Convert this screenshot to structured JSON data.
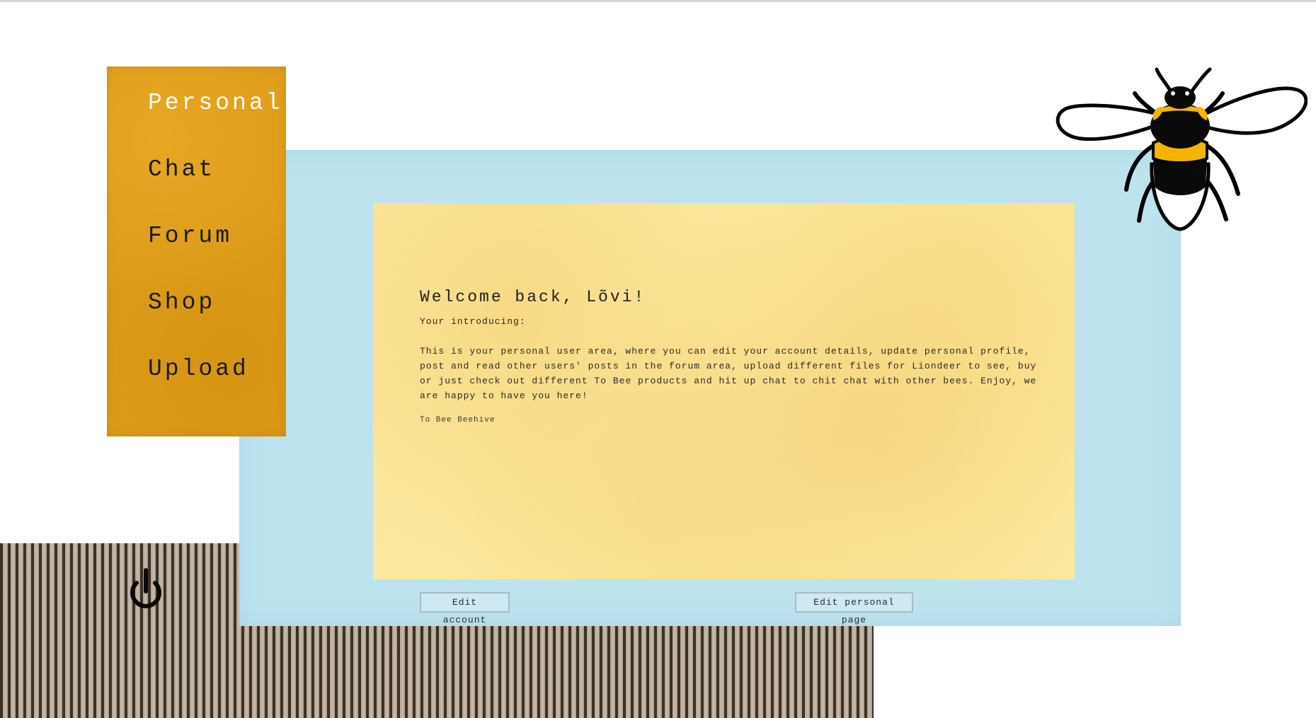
{
  "nav": {
    "items": [
      {
        "label": "Personal",
        "active": true
      },
      {
        "label": "Chat",
        "active": false
      },
      {
        "label": "Forum",
        "active": false
      },
      {
        "label": "Shop",
        "active": false
      },
      {
        "label": "Upload",
        "active": false
      }
    ]
  },
  "main": {
    "welcome": "Welcome back, Lõvi!",
    "intro_label": "Your introducing:",
    "intro_text": "This is your personal user area, where you can edit your account details, update personal profile, post and read other users' posts in the forum area, upload different files for Liondeer to see, buy or just check out different To Bee products and hit up chat to chit chat with other bees. Enjoy, we are happy to have you here!",
    "signature": "To Bee Beehive"
  },
  "buttons": {
    "edit_account": "Edit account",
    "edit_personal_page": "Edit personal page"
  },
  "icons": {
    "power": "power-icon",
    "bee": "bee-illustration"
  },
  "colors": {
    "sidebar": "#dd9c1a",
    "blue_panel": "#bde3ef",
    "yellow_panel": "#fbe9a0",
    "bee_yellow": "#f4b400"
  }
}
